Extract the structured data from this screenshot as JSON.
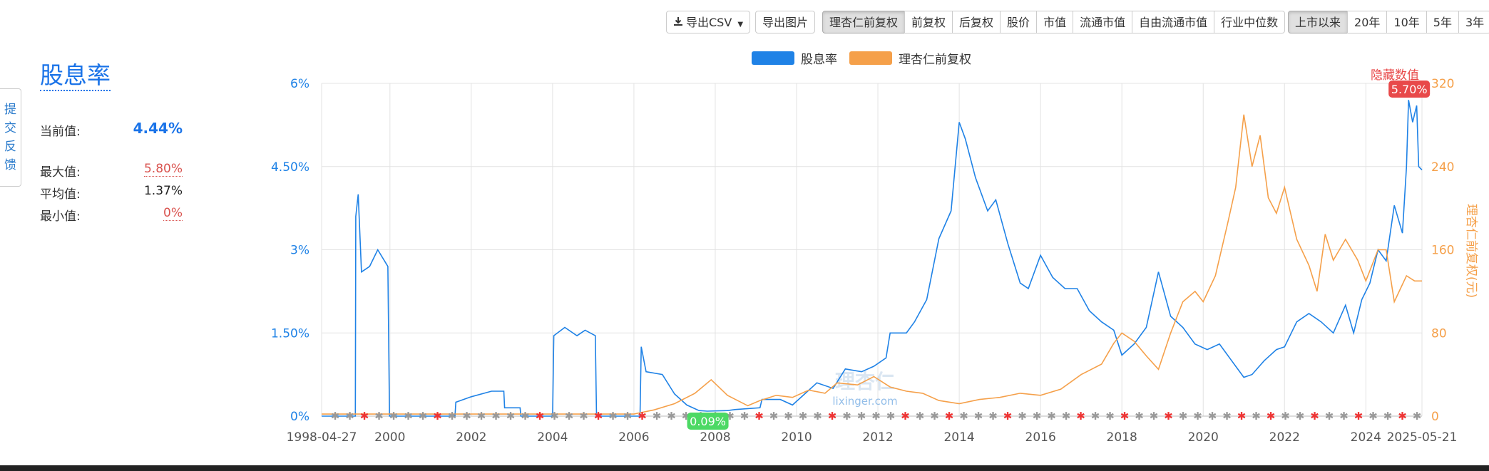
{
  "toolbar": {
    "export_csv": "导出CSV",
    "export_image": "导出图片",
    "adjust_modes": [
      "理杏仁前复权",
      "前复权",
      "后复权",
      "股价",
      "市值",
      "流通市值",
      "自由流通市值",
      "行业中位数"
    ],
    "active_adjust": "理杏仁前复权",
    "ranges": [
      "上市以来",
      "20年",
      "10年",
      "5年",
      "3年"
    ],
    "active_range": "上市以来"
  },
  "feedback": [
    "提",
    "交",
    "反",
    "馈"
  ],
  "metric": {
    "title": "股息率",
    "current_label": "当前值:",
    "current_value": "4.44%",
    "max_label": "最大值:",
    "max_value": "5.80%",
    "avg_label": "平均值:",
    "avg_value": "1.37%",
    "min_label": "最小值:",
    "min_value": "0%"
  },
  "colors": {
    "dividend": "#1f82e6",
    "price": "#f5a04a",
    "max_badge": "#e8494a",
    "min_badge": "#4cd964",
    "hide_values": "#e8494a"
  },
  "hide_values_label": "隐藏数值",
  "watermark": {
    "cn": "理杏仁",
    "en": "lixinger.com"
  },
  "chart_data": {
    "type": "line",
    "legend": [
      "股息率",
      "理杏仁前复权"
    ],
    "legend_position": "top-center",
    "grid": true,
    "x_start": "1998-04-27",
    "x_end": "2025-05-21",
    "x_tick_labels": [
      "1998-04-27",
      "2000",
      "2002",
      "2004",
      "2006",
      "2008",
      "2010",
      "2012",
      "2014",
      "2016",
      "2018",
      "2020",
      "2022",
      "2024",
      "2025-05-21"
    ],
    "y_left_ticks": [
      "0%",
      "1.50%",
      "3%",
      "4.50%",
      "6%"
    ],
    "y_left_range": [
      0,
      6
    ],
    "y_right_ticks": [
      "0",
      "80",
      "160",
      "240",
      "320"
    ],
    "y_right_range": [
      0,
      320
    ],
    "y_right_label": "理杏仁前复权(元)",
    "max_annotation": "5.70%",
    "min_annotation": "0.09%",
    "series": [
      {
        "name": "股息率",
        "axis": "left",
        "points": [
          [
            1998.32,
            0
          ],
          [
            1999.15,
            0
          ],
          [
            1999.16,
            3.6
          ],
          [
            1999.22,
            4.0
          ],
          [
            1999.3,
            2.6
          ],
          [
            1999.5,
            2.7
          ],
          [
            1999.7,
            3.0
          ],
          [
            1999.95,
            2.7
          ],
          [
            1999.99,
            0
          ],
          [
            2001.6,
            0
          ],
          [
            2001.62,
            0.25
          ],
          [
            2002.0,
            0.35
          ],
          [
            2002.5,
            0.45
          ],
          [
            2002.8,
            0.45
          ],
          [
            2002.82,
            0.15
          ],
          [
            2003.2,
            0.15
          ],
          [
            2003.22,
            0
          ],
          [
            2004.0,
            0
          ],
          [
            2004.03,
            1.45
          ],
          [
            2004.3,
            1.6
          ],
          [
            2004.6,
            1.45
          ],
          [
            2004.8,
            1.55
          ],
          [
            2005.05,
            1.45
          ],
          [
            2005.08,
            0
          ],
          [
            2006.15,
            0
          ],
          [
            2006.18,
            1.25
          ],
          [
            2006.3,
            0.8
          ],
          [
            2006.7,
            0.75
          ],
          [
            2007.0,
            0.4
          ],
          [
            2007.3,
            0.2
          ],
          [
            2007.6,
            0.1
          ],
          [
            2007.8,
            0.09
          ],
          [
            2008.3,
            0.1
          ],
          [
            2008.5,
            0.12
          ],
          [
            2009.1,
            0.15
          ],
          [
            2009.15,
            0.3
          ],
          [
            2009.6,
            0.3
          ],
          [
            2009.9,
            0.2
          ],
          [
            2010.2,
            0.4
          ],
          [
            2010.5,
            0.6
          ],
          [
            2010.9,
            0.5
          ],
          [
            2011.2,
            0.85
          ],
          [
            2011.6,
            0.8
          ],
          [
            2011.9,
            0.9
          ],
          [
            2012.2,
            1.05
          ],
          [
            2012.3,
            1.5
          ],
          [
            2012.7,
            1.5
          ],
          [
            2012.9,
            1.7
          ],
          [
            2013.2,
            2.1
          ],
          [
            2013.5,
            3.2
          ],
          [
            2013.8,
            3.7
          ],
          [
            2014.0,
            5.3
          ],
          [
            2014.15,
            5.0
          ],
          [
            2014.4,
            4.3
          ],
          [
            2014.7,
            3.7
          ],
          [
            2014.9,
            3.9
          ],
          [
            2015.2,
            3.1
          ],
          [
            2015.5,
            2.4
          ],
          [
            2015.7,
            2.3
          ],
          [
            2016.0,
            2.9
          ],
          [
            2016.3,
            2.5
          ],
          [
            2016.6,
            2.3
          ],
          [
            2016.9,
            2.3
          ],
          [
            2017.2,
            1.9
          ],
          [
            2017.5,
            1.7
          ],
          [
            2017.8,
            1.55
          ],
          [
            2018.0,
            1.1
          ],
          [
            2018.3,
            1.3
          ],
          [
            2018.6,
            1.6
          ],
          [
            2018.9,
            2.6
          ],
          [
            2019.2,
            1.8
          ],
          [
            2019.5,
            1.6
          ],
          [
            2019.8,
            1.3
          ],
          [
            2020.1,
            1.2
          ],
          [
            2020.4,
            1.3
          ],
          [
            2020.7,
            1.0
          ],
          [
            2021.0,
            0.7
          ],
          [
            2021.2,
            0.75
          ],
          [
            2021.5,
            1.0
          ],
          [
            2021.8,
            1.2
          ],
          [
            2022.0,
            1.25
          ],
          [
            2022.3,
            1.7
          ],
          [
            2022.6,
            1.85
          ],
          [
            2022.9,
            1.7
          ],
          [
            2023.2,
            1.5
          ],
          [
            2023.5,
            2.0
          ],
          [
            2023.7,
            1.5
          ],
          [
            2023.9,
            2.1
          ],
          [
            2024.1,
            2.4
          ],
          [
            2024.3,
            3.0
          ],
          [
            2024.5,
            2.8
          ],
          [
            2024.7,
            3.8
          ],
          [
            2024.9,
            3.3
          ],
          [
            2025.0,
            4.5
          ],
          [
            2025.05,
            5.7
          ],
          [
            2025.15,
            5.3
          ],
          [
            2025.25,
            5.6
          ],
          [
            2025.3,
            4.5
          ],
          [
            2025.38,
            4.44
          ]
        ]
      },
      {
        "name": "理杏仁前复权",
        "axis": "right",
        "points": [
          [
            1998.32,
            2
          ],
          [
            2000,
            2
          ],
          [
            2002,
            2
          ],
          [
            2004,
            2
          ],
          [
            2006,
            2
          ],
          [
            2006.5,
            6
          ],
          [
            2007.0,
            12
          ],
          [
            2007.5,
            22
          ],
          [
            2007.9,
            35
          ],
          [
            2008.3,
            20
          ],
          [
            2008.8,
            10
          ],
          [
            2009.1,
            15
          ],
          [
            2009.5,
            20
          ],
          [
            2009.9,
            18
          ],
          [
            2010.3,
            25
          ],
          [
            2010.7,
            22
          ],
          [
            2011.0,
            32
          ],
          [
            2011.5,
            30
          ],
          [
            2011.9,
            38
          ],
          [
            2012.3,
            28
          ],
          [
            2012.7,
            24
          ],
          [
            2013.1,
            22
          ],
          [
            2013.5,
            15
          ],
          [
            2014.0,
            12
          ],
          [
            2014.5,
            16
          ],
          [
            2015.0,
            18
          ],
          [
            2015.5,
            22
          ],
          [
            2016.0,
            20
          ],
          [
            2016.5,
            26
          ],
          [
            2017.0,
            40
          ],
          [
            2017.5,
            50
          ],
          [
            2017.8,
            70
          ],
          [
            2018.0,
            80
          ],
          [
            2018.3,
            72
          ],
          [
            2018.6,
            58
          ],
          [
            2018.9,
            45
          ],
          [
            2019.2,
            80
          ],
          [
            2019.5,
            110
          ],
          [
            2019.8,
            120
          ],
          [
            2020.0,
            110
          ],
          [
            2020.3,
            135
          ],
          [
            2020.6,
            185
          ],
          [
            2020.8,
            220
          ],
          [
            2021.0,
            290
          ],
          [
            2021.2,
            240
          ],
          [
            2021.4,
            270
          ],
          [
            2021.6,
            210
          ],
          [
            2021.8,
            195
          ],
          [
            2022.0,
            220
          ],
          [
            2022.3,
            170
          ],
          [
            2022.6,
            145
          ],
          [
            2022.8,
            120
          ],
          [
            2023.0,
            175
          ],
          [
            2023.2,
            150
          ],
          [
            2023.5,
            170
          ],
          [
            2023.8,
            150
          ],
          [
            2024.0,
            130
          ],
          [
            2024.3,
            160
          ],
          [
            2024.5,
            160
          ],
          [
            2024.7,
            110
          ],
          [
            2025.0,
            135
          ],
          [
            2025.2,
            130
          ],
          [
            2025.38,
            130
          ]
        ]
      }
    ]
  }
}
